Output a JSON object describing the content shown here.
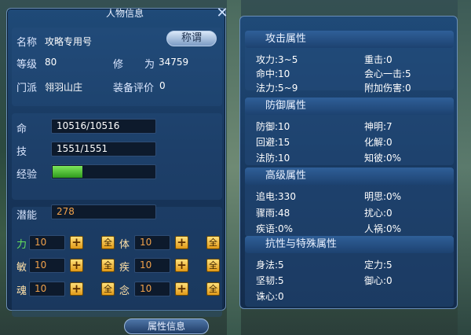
{
  "window": {
    "title": "人物信息"
  },
  "profile": {
    "name_label": "名称",
    "name_value": "攻略专用号",
    "title_button": "称谓",
    "level_label": "等级",
    "level_value": "80",
    "cultivation_label_1": "修",
    "cultivation_label_2": "为",
    "cultivation_value": "34759",
    "sect_label": "门派",
    "sect_value": "翎羽山庄",
    "equip_label": "装备评价",
    "equip_value": "0"
  },
  "vitals": {
    "hp_label": "命",
    "hp_value": "10516/10516",
    "skill_label": "技",
    "skill_value": "1551/1551",
    "exp_label": "经验",
    "exp_fraction": 0.29
  },
  "potential": {
    "label": "潜能",
    "value": "278"
  },
  "attributes": [
    {
      "label": "力",
      "value": "10"
    },
    {
      "label": "体",
      "value": "10"
    },
    {
      "label": "敏",
      "value": "10"
    },
    {
      "label": "疾",
      "value": "10"
    },
    {
      "label": "魂",
      "value": "10"
    },
    {
      "label": "念",
      "value": "10"
    }
  ],
  "buttons": {
    "plus_glyph": "+",
    "all_glyph": "全",
    "bottom_tab": "属性信息"
  },
  "right": {
    "attack": {
      "title": "攻击属性",
      "rows": [
        [
          "攻力:3~5",
          "重击:0"
        ],
        [
          "命中:10",
          "会心一击:5"
        ],
        [
          "法力:5~9",
          "附加伤害:0"
        ]
      ]
    },
    "defense": {
      "title": "防御属性",
      "rows": [
        [
          "防御:10",
          "神明:7"
        ],
        [
          "回避:15",
          "化解:0"
        ],
        [
          "法防:10",
          "知彼:0%"
        ]
      ]
    },
    "advanced": {
      "title": "高级属性",
      "rows": [
        [
          "追电:330",
          "明思:0%"
        ],
        [
          "骤雨:48",
          "扰心:0"
        ],
        [
          "疾语:0%",
          "人祸:0%"
        ]
      ]
    },
    "resist": {
      "title": "抗性与特殊属性",
      "rows": [
        [
          "身法:5",
          "定力:5"
        ],
        [
          "坚韧:5",
          "御心:0"
        ],
        [
          "诛心:0",
          ""
        ]
      ]
    }
  }
}
